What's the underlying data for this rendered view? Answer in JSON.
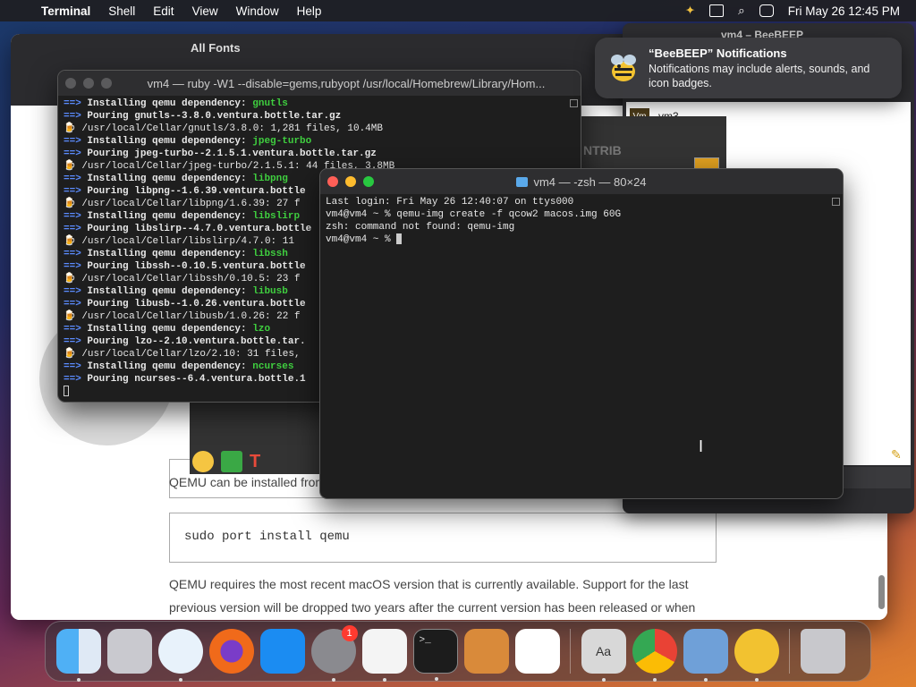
{
  "menubar": {
    "app": "Terminal",
    "items": [
      "Shell",
      "Edit",
      "View",
      "Window",
      "Help"
    ],
    "datetime": "Fri May 26  12:45 PM"
  },
  "background": {
    "fontbook_title": "All Fonts",
    "beebeep_title": "vm4 – BeeBEEP",
    "vm_label": "vm3",
    "partial_label": "NTRIB",
    "para1": "QEMU can be installed from MacPorts:",
    "code": "sudo port install qemu",
    "para2": "QEMU requires the most recent macOS version that is currently available. Support for the last previous version will be dropped two years after the current version has been released or when Apple drops support for it, whatever comes first."
  },
  "terminal1": {
    "title": "vm4 — ruby -W1 --disable=gems,rubyopt /usr/local/Homebrew/Library/Hom...",
    "lines": [
      {
        "k": "dep",
        "a": "==>",
        "t": "Installing qemu dependency: ",
        "g": "gnutls"
      },
      {
        "k": "pour",
        "a": "==>",
        "t": "Pouring gnutls--3.8.0.ventura.bottle.tar.gz"
      },
      {
        "k": "beer",
        "t": "/usr/local/Cellar/gnutls/3.8.0: 1,281 files, 10.4MB"
      },
      {
        "k": "dep",
        "a": "==>",
        "t": "Installing qemu dependency: ",
        "g": "jpeg-turbo"
      },
      {
        "k": "pour",
        "a": "==>",
        "t": "Pouring jpeg-turbo--2.1.5.1.ventura.bottle.tar.gz"
      },
      {
        "k": "beer",
        "t": "/usr/local/Cellar/jpeg-turbo/2.1.5.1: 44 files, 3.8MB"
      },
      {
        "k": "dep",
        "a": "==>",
        "t": "Installing qemu dependency: ",
        "g": "libpng"
      },
      {
        "k": "pour",
        "a": "==>",
        "t": "Pouring libpng--1.6.39.ventura.bottle"
      },
      {
        "k": "beer",
        "t": "/usr/local/Cellar/libpng/1.6.39: 27 f"
      },
      {
        "k": "dep",
        "a": "==>",
        "t": "Installing qemu dependency: ",
        "g": "libslirp"
      },
      {
        "k": "pour",
        "a": "==>",
        "t": "Pouring libslirp--4.7.0.ventura.bottle"
      },
      {
        "k": "beer",
        "t": "/usr/local/Cellar/libslirp/4.7.0: 11"
      },
      {
        "k": "dep",
        "a": "==>",
        "t": "Installing qemu dependency: ",
        "g": "libssh"
      },
      {
        "k": "pour",
        "a": "==>",
        "t": "Pouring libssh--0.10.5.ventura.bottle"
      },
      {
        "k": "beer",
        "t": "/usr/local/Cellar/libssh/0.10.5: 23 f"
      },
      {
        "k": "dep",
        "a": "==>",
        "t": "Installing qemu dependency: ",
        "g": "libusb"
      },
      {
        "k": "pour",
        "a": "==>",
        "t": "Pouring libusb--1.0.26.ventura.bottle"
      },
      {
        "k": "beer",
        "t": "/usr/local/Cellar/libusb/1.0.26: 22 f"
      },
      {
        "k": "dep",
        "a": "==>",
        "t": "Installing qemu dependency: ",
        "g": "lzo"
      },
      {
        "k": "pour",
        "a": "==>",
        "t": "Pouring lzo--2.10.ventura.bottle.tar."
      },
      {
        "k": "beer",
        "t": "/usr/local/Cellar/lzo/2.10: 31 files,"
      },
      {
        "k": "dep",
        "a": "==>",
        "t": "Installing qemu dependency: ",
        "g": "ncurses"
      },
      {
        "k": "pour",
        "a": "==>",
        "t": "Pouring ncurses--6.4.ventura.bottle.1"
      }
    ]
  },
  "terminal2": {
    "title": "vm4 — -zsh — 80×24",
    "lines": [
      "Last login: Fri May 26 12:40:07 on ttys000",
      "vm4@vm4 ~ % qemu-img create -f qcow2 macos.img 60G",
      "zsh: command not found: qemu-img",
      "vm4@vm4 ~ % "
    ]
  },
  "notification": {
    "title": "“BeeBEEP” Notifications",
    "message": "Notifications may include alerts, sounds, and icon badges."
  },
  "dock": {
    "settings_badge": "1",
    "items": [
      "finder-icon",
      "launchpad-icon",
      "safari-icon",
      "firefox-icon",
      "app-store-icon",
      "system-settings-icon",
      "textedit-icon",
      "terminal-icon",
      "garageband-icon",
      "vscode-icon",
      "font-book-icon",
      "chrome-icon",
      "virtualbox-icon",
      "beebeep-icon",
      "trash-icon"
    ]
  }
}
